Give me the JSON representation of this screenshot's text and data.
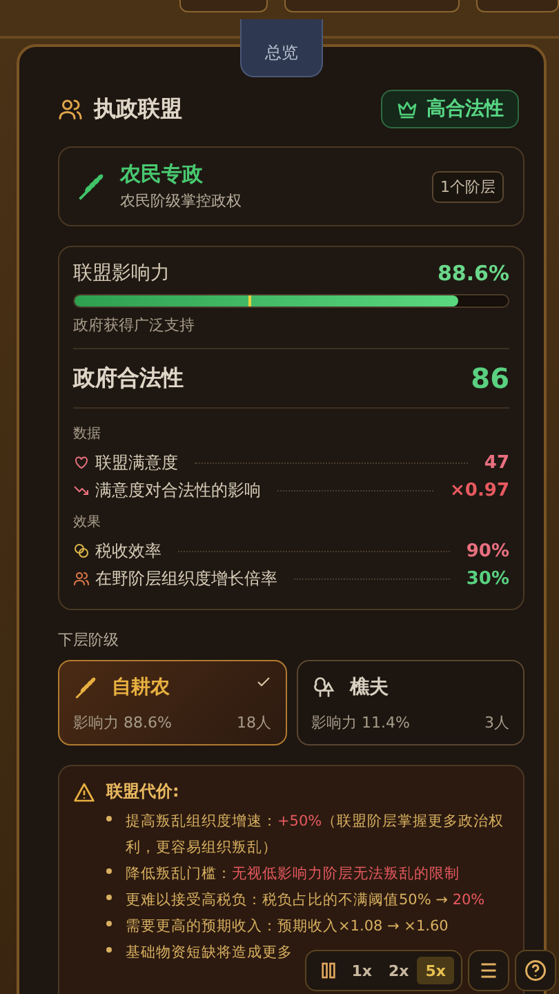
{
  "tab": {
    "label": "总览",
    "selected": true
  },
  "coalition": {
    "title": "执政联盟",
    "badge": "高合法性"
  },
  "regime": {
    "name": "农民专政",
    "description": "农民阶级掌控政权",
    "count": "1个阶层"
  },
  "influence": {
    "label": "联盟影响力",
    "value": "88.6%",
    "level": 0.886,
    "note": "政府获得广泛支持"
  },
  "legitimacy": {
    "label": "政府合法性",
    "value": "86"
  },
  "data_section": {
    "title": "数据",
    "rows": [
      {
        "label": "联盟满意度",
        "value": "47",
        "color": "#e87080"
      },
      {
        "label": "满意度对合法性的影响",
        "value": "×0.97",
        "color": "#e85a60"
      }
    ]
  },
  "effects_section": {
    "title": "效果",
    "rows": [
      {
        "label": "税收效率",
        "value": "90%",
        "color": "#e87080"
      },
      {
        "label": "在野阶层组织度增长倍率",
        "value": "30%",
        "color": "#58d080"
      }
    ]
  },
  "subclasses": {
    "title": "下层阶级",
    "items": [
      {
        "name": "自耕农",
        "influence": "影响力 88.6%",
        "count": "18人",
        "selected": true
      },
      {
        "name": "樵夫",
        "influence": "影响力 11.4%",
        "count": "3人",
        "selected": false
      }
    ]
  },
  "costs": {
    "title": "联盟代价:",
    "items": [
      [
        {
          "text": "提高叛乱组织度增速：",
          "highlight": false
        },
        {
          "text": "+50%",
          "highlight": true
        },
        {
          "text": "（联盟阶层掌握更多政治权利，更容易组织叛乱）",
          "highlight": false
        }
      ],
      [
        {
          "text": "降低叛乱门槛：",
          "highlight": false
        },
        {
          "text": "无视低影响力阶层无法叛乱的限制",
          "highlight": true
        }
      ],
      [
        {
          "text": "更难以接受高税负：税负占比的不满阈值50% → ",
          "highlight": false
        },
        {
          "text": "20%",
          "highlight": true
        }
      ],
      [
        {
          "text": "需要更高的预期收入：预期收入×1.08 → ×1.60",
          "highlight": false
        }
      ],
      [
        {
          "text": "基础物资短缺将造成更多",
          "highlight": false
        }
      ]
    ]
  },
  "toolbar": {
    "speeds": [
      {
        "kind": "pause",
        "selected": false
      },
      {
        "kind": "text",
        "label": "1x",
        "selected": false
      },
      {
        "kind": "text",
        "label": "2x",
        "selected": false
      },
      {
        "kind": "text",
        "label": "5x",
        "selected": true
      }
    ]
  }
}
